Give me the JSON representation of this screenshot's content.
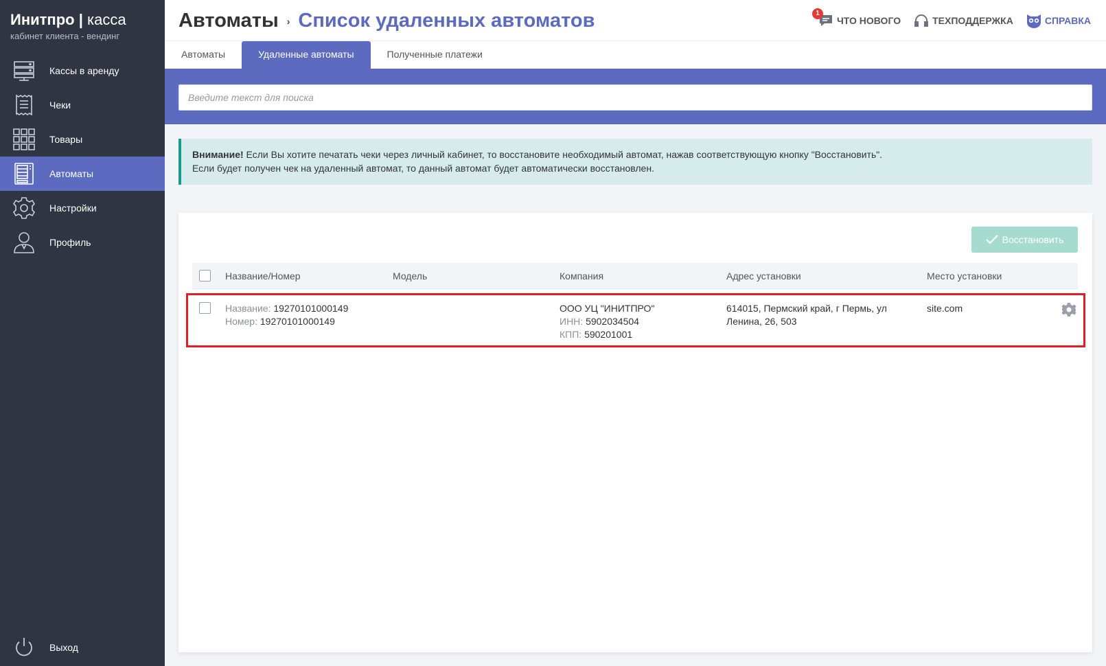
{
  "brand": {
    "name": "Инитпро",
    "separator": "|",
    "product": "касса",
    "subtitle": "кабинет клиента - вендинг"
  },
  "sidebar": {
    "items": [
      {
        "label": "Кассы в аренду",
        "icon": "server-icon",
        "active": false
      },
      {
        "label": "Чеки",
        "icon": "receipt-icon",
        "active": false
      },
      {
        "label": "Товары",
        "icon": "grid-icon",
        "active": false
      },
      {
        "label": "Автоматы",
        "icon": "vending-machine-icon",
        "active": true
      },
      {
        "label": "Настройки",
        "icon": "gear-icon",
        "active": false
      },
      {
        "label": "Профиль",
        "icon": "user-icon",
        "active": false
      }
    ],
    "logout_label": "Выход"
  },
  "header": {
    "breadcrumb_root": "Автоматы",
    "breadcrumb_separator": "›",
    "breadcrumb_current": "Список удаленных автоматов",
    "whats_new_label": "Что нового",
    "whats_new_badge": "1",
    "support_label": "Техподдержка",
    "help_label": "Справка"
  },
  "tabs": [
    {
      "label": "Автоматы",
      "active": false
    },
    {
      "label": "Удаленные автоматы",
      "active": true
    },
    {
      "label": "Полученные платежи",
      "active": false
    }
  ],
  "search": {
    "placeholder": "Введите текст для поиска",
    "value": ""
  },
  "alert": {
    "strong": "Внимание!",
    "line1": " Если Вы хотите печатать чеки через личный кабинет, то восстановите необходимый автомат, нажав соответствующую кнопку \"Восстановить\".",
    "line2": "Если будет получен чек на удаленный автомат, то данный автомат будет автоматически восстановлен."
  },
  "table": {
    "restore_button": "Восстановить",
    "columns": [
      "Название/Номер",
      "Модель",
      "Компания",
      "Адрес установки",
      "Место установки"
    ],
    "rows": [
      {
        "name_label": "Название:",
        "name": "19270101000149",
        "number_label": "Номер:",
        "number": "19270101000149",
        "model": "",
        "company": "ООО УЦ \"ИНИТПРО\"",
        "inn_label": "ИНН:",
        "inn": "5902034504",
        "kpp_label": "КПП:",
        "kpp": "590201001",
        "address_line1": "614015, Пермский край, г Пермь, ул",
        "address_line2": "Ленина, 26, 503",
        "place": "site.com"
      }
    ]
  },
  "colors": {
    "sidebar_bg": "#2f3542",
    "accent": "#5c6bc0",
    "alert_bg": "#d6ecec",
    "alert_border": "#1a9a8c",
    "restore_bg": "#a6dccf",
    "highlight": "#e01e26"
  }
}
